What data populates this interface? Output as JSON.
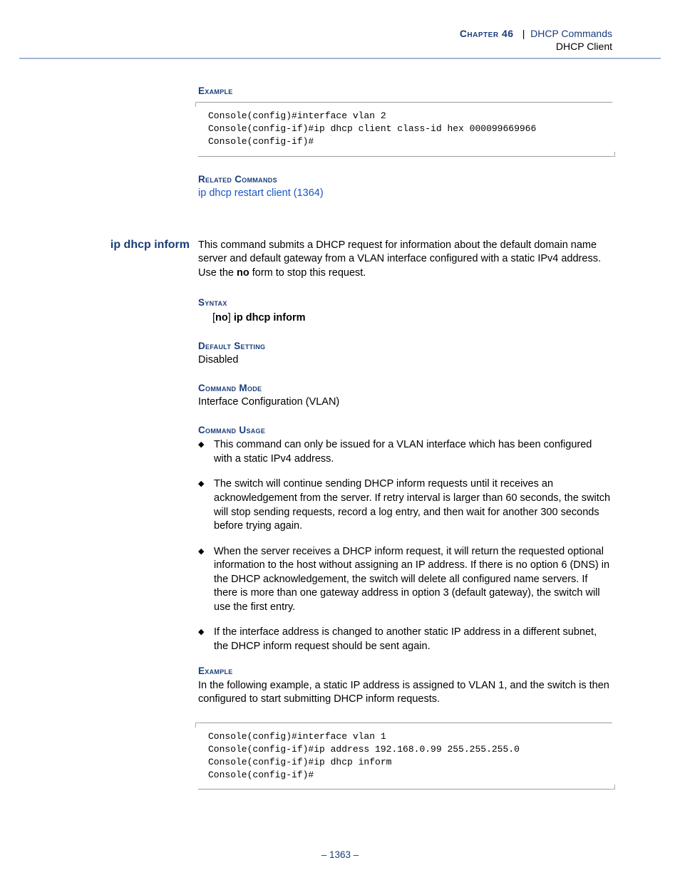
{
  "header": {
    "chapter_label": "Chapter",
    "chapter_num": "46",
    "separator": "|",
    "chapter_title": "DHCP Commands",
    "subtitle": "DHCP Client"
  },
  "top": {
    "example_label": "Example",
    "code": "Console(config)#interface vlan 2\nConsole(config-if)#ip dhcp client class-id hex 000099669966\nConsole(config-if)#",
    "related_label": "Related Commands",
    "related_link": "ip dhcp restart client (1364)"
  },
  "cmd": {
    "name": "ip dhcp inform",
    "desc_pre": "This command submits a DHCP request for information about the default domain name server and default gateway from a VLAN interface configured with a static IPv4 address. Use the ",
    "desc_bold": "no",
    "desc_post": " form to stop this request.",
    "syntax_label": "Syntax",
    "syntax_br1": "[",
    "syntax_no": "no",
    "syntax_br2": "] ",
    "syntax_cmd": "ip dhcp inform",
    "default_label": "Default Setting",
    "default_val": "Disabled",
    "mode_label": "Command Mode",
    "mode_val": "Interface Configuration (VLAN)",
    "usage_label": "Command Usage",
    "bullets": [
      "This command can only be issued for a VLAN interface which has been configured with a static IPv4 address.",
      "The switch will continue sending DHCP inform requests until it receives an acknowledgement from the server. If retry interval is larger than 60 seconds, the switch will stop sending requests, record a log entry, and then wait for another 300 seconds before trying again.",
      "When the server receives a DHCP inform request, it will return the requested optional information to the host without assigning an IP address. If there is no option 6 (DNS) in the DHCP acknowledgement, the switch will delete all configured name servers. If there is more than one gateway address in option 3 (default gateway), the switch will use the first entry.",
      "If the interface address is changed to another static IP address in a different subnet, the DHCP inform request should be sent again."
    ],
    "example_label": "Example",
    "example_text": "In the following example, a static IP address is assigned to VLAN 1, and the switch is then configured to start submitting DHCP inform requests.",
    "example_code": "Console(config)#interface vlan 1\nConsole(config-if)#ip address 192.168.0.99 255.255.255.0\nConsole(config-if)#ip dhcp inform\nConsole(config-if)#"
  },
  "page_num": "–  1363  –"
}
